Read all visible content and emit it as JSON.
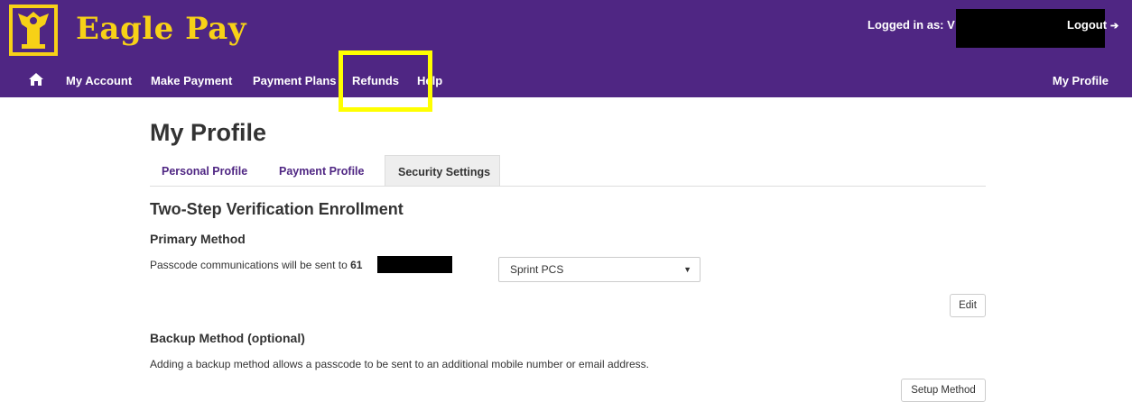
{
  "app": {
    "brand": "Eagle Pay",
    "logged_in_label": "Logged in as: V",
    "logout_label": "Logout"
  },
  "nav": {
    "items": [
      "My Account",
      "Make Payment",
      "Payment Plans",
      "Refunds",
      "Help"
    ],
    "right": "My Profile"
  },
  "page": {
    "title": "My Profile",
    "tabs": [
      {
        "label": "Personal Profile",
        "active": false
      },
      {
        "label": "Payment Profile",
        "active": false
      },
      {
        "label": "Security Settings",
        "active": true
      }
    ]
  },
  "enrollment": {
    "title": "Two-Step Verification Enrollment",
    "primary": {
      "heading": "Primary Method",
      "text": "Passcode communications will be sent to ",
      "phone_prefix": "61",
      "carrier": "Sprint PCS",
      "edit_label": "Edit"
    },
    "backup": {
      "heading": "Backup Method (optional)",
      "text": "Adding a backup method allows a passcode to be sent to an additional mobile number or email address.",
      "setup_label": "Setup Method"
    }
  },
  "colors": {
    "brand_purple": "#4f2683",
    "brand_gold": "#f7d117",
    "highlight": "#ffff00"
  }
}
